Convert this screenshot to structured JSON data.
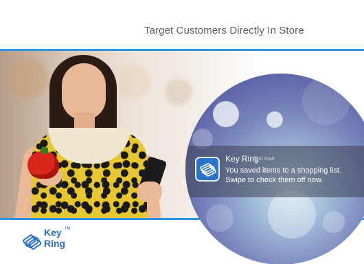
{
  "header": {
    "headline": "Target Customers Directly In Store"
  },
  "notification": {
    "app_name": "Key Ring",
    "time": "Just now",
    "line1": "You saved items to a shopping list.",
    "line2": "Swipe to check them off now."
  },
  "logo": {
    "word1": "Key",
    "word2": "Ring",
    "tm": "TM"
  },
  "colors": {
    "accent_blue": "#2c95df",
    "brand_blue": "#2a73c8"
  }
}
